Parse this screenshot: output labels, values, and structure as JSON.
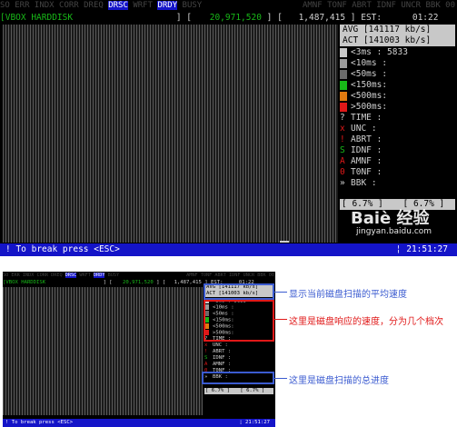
{
  "colors": {
    "highlight": "#1414c8",
    "lt3ms": "#c8c8c8",
    "lt10ms": "#9a9a9a",
    "lt50ms": "#6a6a6a",
    "lt150ms": "#18b818",
    "lt500ms": "#e07a10",
    "gt500ms": "#e01818",
    "anno_blue": "#3b5bd0",
    "anno_red": "#e01818"
  },
  "header": {
    "flags_left": [
      "SO",
      "ERR",
      "INDX",
      "CORR",
      "DREQ"
    ],
    "flag_drsc": "DRSC",
    "flag_wrft": "WRFT",
    "flag_drdy": "DRDY",
    "flag_busy": "BUSY",
    "flags_right": "AMNF  TONF  ABRT  IDNF  UNCR  BBK  00"
  },
  "infobar": {
    "disk_name": "[VBOX HARDDISK",
    "capacity_open": "]  [",
    "capacity": "20,971,520",
    "position_open": "]  [",
    "position": "1,487,415",
    "est_label": "] EST:",
    "est_value": "01:22"
  },
  "panel": {
    "avg": "AVG [141117 kb/s]",
    "act": "ACT [141003 kb/s]",
    "latency_rows": [
      {
        "label": "<3ms  : 5833",
        "color_key": "lt3ms"
      },
      {
        "label": "<10ms :",
        "color_key": "lt10ms"
      },
      {
        "label": "<50ms :",
        "color_key": "lt50ms"
      },
      {
        "label": "<150ms:",
        "color_key": "lt150ms"
      },
      {
        "label": "<500ms:",
        "color_key": "lt500ms"
      },
      {
        "label": ">500ms:",
        "color_key": "gt500ms"
      }
    ],
    "error_rows": [
      {
        "symbol": "?",
        "label": "TIME :",
        "symbol_color": "#d0d0d0"
      },
      {
        "symbol": "x",
        "label": "UNC  :",
        "symbol_color": "#e01818"
      },
      {
        "symbol": "!",
        "label": "ABRT :",
        "symbol_color": "#e01818"
      },
      {
        "symbol": "S",
        "label": "IDNF :",
        "symbol_color": "#18b818"
      },
      {
        "symbol": "A",
        "label": "AMNF :",
        "symbol_color": "#e01818"
      },
      {
        "symbol": "0",
        "label": "T0NF :",
        "symbol_color": "#e01818"
      },
      {
        "symbol": "»",
        "label": "BBK  :",
        "symbol_color": "#d0d0d0"
      }
    ],
    "progress_left": "[  6.7% ]",
    "progress_right": "[  6.7% ]",
    "progress_fraction": 0.067
  },
  "footer": {
    "break_hint": "! To break press <ESC>",
    "clock": "¦ 21:51:27"
  },
  "watermark": {
    "logo": "Baiè 经验",
    "url": "jingyan.baidu.com"
  },
  "annotations": {
    "speed": "显示当前磁盘扫描的平均速度",
    "latency": "这里是磁盘响应的速度，分为几个档次",
    "progress": "这里是磁盘扫描的总进度"
  }
}
